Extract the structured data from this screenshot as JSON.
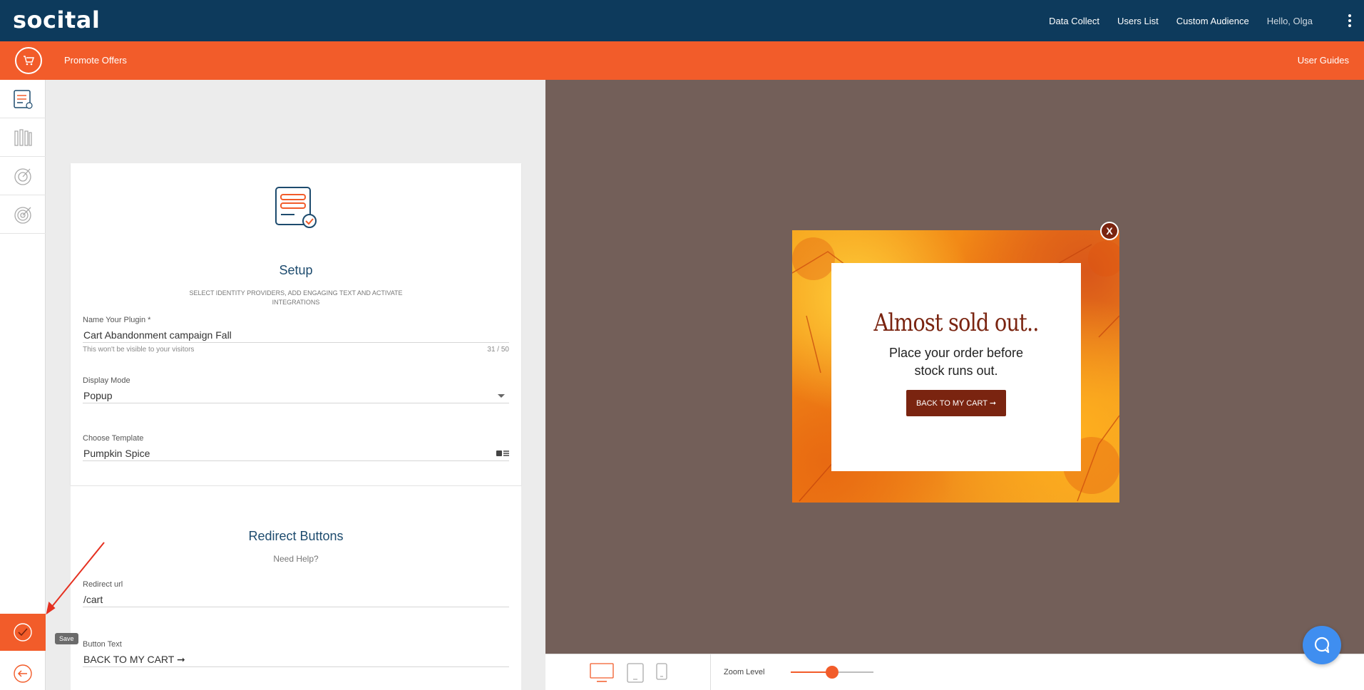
{
  "header": {
    "logo": "socital",
    "nav": [
      "Data Collect",
      "Users List",
      "Custom Audience"
    ],
    "greeting": "Hello, Olga"
  },
  "subbar": {
    "title": "Promote Offers",
    "guides": "User Guides"
  },
  "rail": {
    "save_tooltip": "Save"
  },
  "setup": {
    "title": "Setup",
    "subtitle": "SELECT IDENTITY PROVIDERS, ADD ENGAGING TEXT AND ACTIVATE INTEGRATIONS",
    "plugin_name": {
      "label": "Name Your Plugin *",
      "value": "Cart Abandonment campaign Fall",
      "hint": "This won't be visible to your visitors",
      "counter": "31 / 50"
    },
    "display_mode": {
      "label": "Display Mode",
      "value": "Popup"
    },
    "template": {
      "label": "Choose Template",
      "value": "Pumpkin Spice"
    }
  },
  "redirect": {
    "title": "Redirect Buttons",
    "help": "Need Help?",
    "url": {
      "label": "Redirect url",
      "value": "/cart"
    },
    "button_text": {
      "label": "Button Text",
      "value": "BACK TO MY CART ➞"
    }
  },
  "preview": {
    "headline": "Almost sold out..",
    "text_line1": "Place your order before",
    "text_line2": "stock runs out.",
    "button": "BACK TO MY CART ➞",
    "close": "X"
  },
  "bottombar": {
    "zoom_label": "Zoom Level",
    "zoom_level": 0.5,
    "selected_device": "desktop"
  },
  "colors": {
    "navy": "#0d3a5c",
    "orange": "#f25c2a",
    "preview_bg": "#735f59",
    "brand_dark": "#7a2410",
    "chat": "#3f8ef0"
  }
}
